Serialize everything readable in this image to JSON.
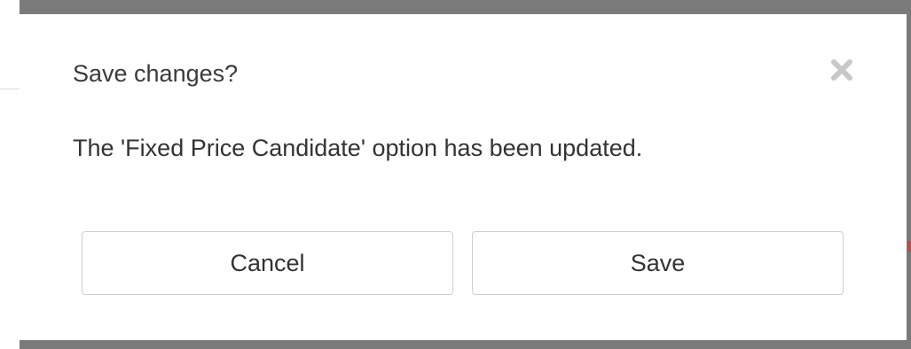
{
  "dialog": {
    "title": "Save changes?",
    "message": "The 'Fixed Price Candidate' option has been updated.",
    "close_icon": "close-icon",
    "buttons": {
      "cancel_label": "Cancel",
      "save_label": "Save"
    }
  },
  "colors": {
    "overlay": "#7a7a7a",
    "dialog_background": "#ffffff",
    "text": "#333333",
    "close_icon": "#c8c8c8",
    "button_border": "#cfcfcf"
  }
}
